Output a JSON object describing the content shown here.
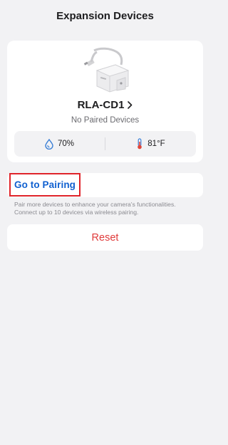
{
  "header": {
    "title": "Expansion Devices"
  },
  "device": {
    "name": "RLA-CD1",
    "status": "No Paired Devices",
    "image_icon": "sensor-device-image",
    "stats": {
      "humidity": {
        "icon": "water-drop-icon",
        "value": "70%"
      },
      "temperature": {
        "icon": "thermometer-icon",
        "value": "81°F"
      }
    }
  },
  "pairing": {
    "button_label": "Go to Pairing",
    "hint": "Pair more devices to enhance your camera's functionalities. Connect up to 10 devices via wireless pairing."
  },
  "reset": {
    "label": "Reset"
  },
  "colors": {
    "background": "#f2f2f4",
    "card": "#ffffff",
    "link_blue": "#1060d0",
    "reset_red": "#e03b3b",
    "highlight_red": "#e0242a"
  }
}
